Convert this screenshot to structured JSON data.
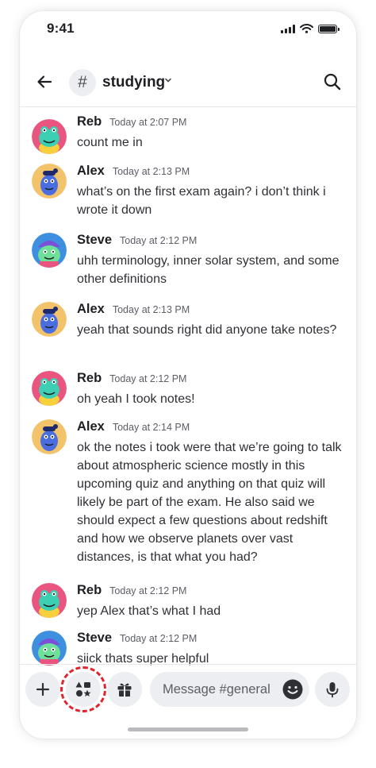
{
  "status_bar": {
    "time": "9:41"
  },
  "header": {
    "channel_prefix": "#",
    "channel_name": "studying"
  },
  "messages": [
    {
      "author": "Reb",
      "timestamp": "Today at 2:07 PM",
      "text": "count me in",
      "avatar": "reb-avatar"
    },
    {
      "author": "Alex",
      "timestamp": "Today at 2:13 PM",
      "text": "what’s on the first exam again? i don’t think i wrote it down",
      "avatar": "alex-avatar"
    },
    {
      "author": "Steve",
      "timestamp": "Today at 2:12 PM",
      "text": "uhh terminology, inner solar system, and some other definitions",
      "avatar": "steve-avatar"
    },
    {
      "author": "Alex",
      "timestamp": "Today at 2:13 PM",
      "text": "yeah that sounds right did anyone take notes?",
      "avatar": "alex-avatar"
    },
    {
      "author": "Reb",
      "timestamp": "Today at 2:12 PM",
      "text": "oh yeah I took notes!",
      "avatar": "reb-avatar"
    },
    {
      "author": "Alex",
      "timestamp": "Today at 2:14 PM",
      "text": "ok the notes i took were that we’re going to talk about atmospheric science mostly in this upcoming quiz and anything on that quiz will likely be part of the exam. He also said we should expect a few questions about redshift and how we observe planets over vast distances, is that what you had?",
      "avatar": "alex-avatar"
    },
    {
      "author": "Reb",
      "timestamp": "Today at 2:12 PM",
      "text": "yep Alex that’s what I had",
      "avatar": "reb-avatar"
    },
    {
      "author": "Steve",
      "timestamp": "Today at 2:12 PM",
      "text": "siick thats super helpful",
      "avatar": "steve-avatar"
    }
  ],
  "input_bar": {
    "placeholder": "Message #general"
  },
  "colors": {
    "highlight": "#e3232b",
    "reb": "#e9557f",
    "alex": "#f2c36b",
    "steve": "#3f8fe0"
  }
}
